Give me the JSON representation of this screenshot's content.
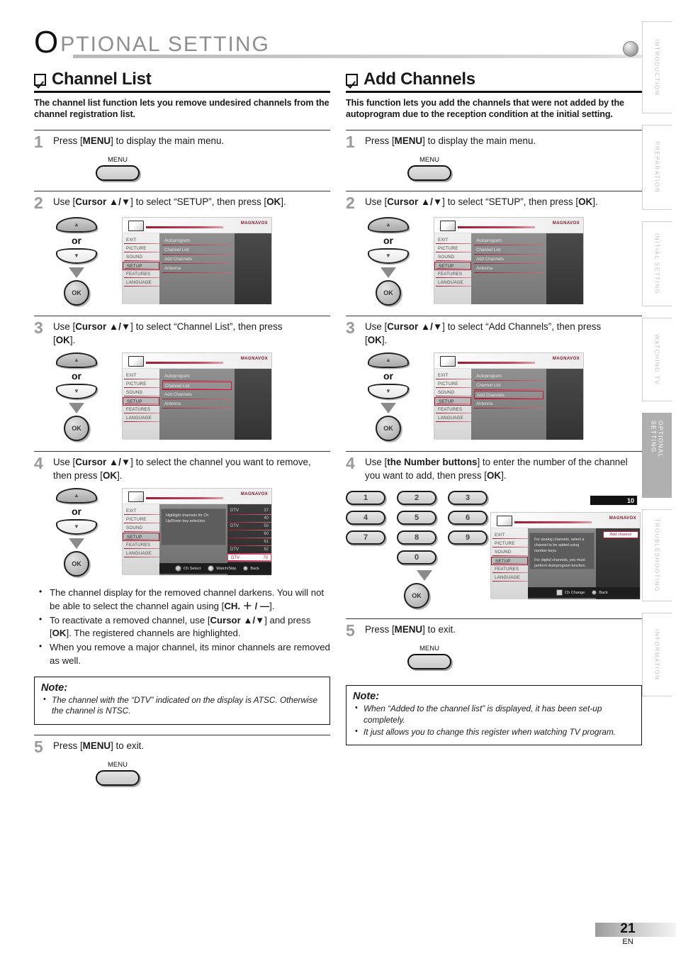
{
  "header": {
    "initial": "O",
    "rest": "PTIONAL  SETTING"
  },
  "sidebar": {
    "tabs": [
      {
        "label": "INTRODUCTION",
        "active": false
      },
      {
        "label": "PREPARATION",
        "active": false
      },
      {
        "label": "INITIAL  SETTING",
        "active": false
      },
      {
        "label": "WATCHING  TV",
        "active": false
      },
      {
        "label": "OPTIONAL  SETTING",
        "active": true
      },
      {
        "label": "TROUBLESHOOTING",
        "active": false
      },
      {
        "label": "INFORMATION",
        "active": false
      }
    ]
  },
  "footer": {
    "page_number": "21",
    "language": "EN"
  },
  "left": {
    "title": "Channel List",
    "description": "The channel list function lets you remove undesired channels from the channel registration list.",
    "steps": [
      {
        "num": "1",
        "text": "Press [MENU] to display the main menu.",
        "menu_label": "MENU"
      },
      {
        "num": "2",
        "text": "Use [Cursor ▲/▼] to select “SETUP”, then press [OK].",
        "or": "or",
        "ok": "OK"
      },
      {
        "num": "3",
        "text": "Use [Cursor ▲/▼] to select “Channel List”, then press [OK].",
        "or": "or",
        "ok": "OK"
      },
      {
        "num": "4",
        "text": "Use [Cursor ▲/▼] to select the channel you want to remove, then press [OK].",
        "or": "or",
        "ok": "OK"
      },
      {
        "num": "5",
        "text": "Press [MENU] to exit.",
        "menu_label": "MENU"
      }
    ],
    "bullets": [
      "The channel display for the removed channel darkens. You will not be able to select the channel again using [CH. ＋ / —].",
      "To reactivate a removed channel, use [Cursor ▲/▼] and press [OK]. The registered channels are highlighted.",
      "When you remove a major channel, its minor channels are removed as well."
    ],
    "note": {
      "title": "Note:",
      "items": [
        "The channel with the “DTV” indicated on the display is ATSC. Otherwise the channel is NTSC."
      ]
    }
  },
  "right": {
    "title": "Add Channels",
    "description": "This function lets you add the channels that were not added by the autoprogram due to the reception condition at the initial setting.",
    "steps": [
      {
        "num": "1",
        "text": "Press [MENU] to display the main menu.",
        "menu_label": "MENU"
      },
      {
        "num": "2",
        "text": "Use [Cursor ▲/▼] to select “SETUP”, then press [OK].",
        "or": "or",
        "ok": "OK"
      },
      {
        "num": "3",
        "text": "Use [Cursor ▲/▼] to select “Add Channels”, then press [OK].",
        "or": "or",
        "ok": "OK"
      },
      {
        "num": "4",
        "text": "Use [the Number buttons] to enter the number of the channel you want to add, then press [OK].",
        "ok": "OK"
      },
      {
        "num": "5",
        "text": "Press [MENU] to exit.",
        "menu_label": "MENU"
      }
    ],
    "numpad": {
      "keys": [
        "1",
        "2",
        "3",
        "4",
        "5",
        "6",
        "7",
        "8",
        "9",
        "0"
      ],
      "ok": "OK"
    },
    "note": {
      "title": "Note:",
      "items": [
        "When “Added to the channel list” is displayed, it has been set-up completely.",
        "It just allows you to change this register when watching TV program."
      ]
    }
  },
  "osd": {
    "brand": "MAGNAVOX",
    "left_menu": [
      "EXIT",
      "PICTURE",
      "SOUND",
      "SETUP",
      "FEATURES",
      "LANGUAGE"
    ],
    "setup_items": [
      "Autoprogram",
      "Channel List",
      "Add Channels",
      "Antenna"
    ],
    "selected_left": "SETUP",
    "selected_step2": "",
    "selected_step3_left": "Channel List",
    "selected_step3_right": "Add Channels",
    "channel_list": {
      "hint": "Highlight channels for Ch Up/Down key selection.",
      "rows": [
        {
          "type": "DTV",
          "num": "37",
          "sel": false
        },
        {
          "type": "",
          "num": "40",
          "sel": false
        },
        {
          "type": "DTV",
          "num": "50",
          "sel": false
        },
        {
          "type": "",
          "num": "60",
          "sel": false
        },
        {
          "type": "",
          "num": "61",
          "sel": false
        },
        {
          "type": "DTV",
          "num": "62",
          "sel": false
        },
        {
          "type": "DTV",
          "num": "70",
          "sel": true
        }
      ],
      "footer": [
        "Ch Select",
        "Watch/Skip",
        "Back"
      ]
    },
    "add_channel": {
      "badge": "10",
      "tag": "Add channel",
      "message_1": "For analog channels, select a channel to be added using number keys.",
      "message_2": "For digital channels, you must perform Autoprogram function.",
      "footer": [
        "Ch Change",
        "Back"
      ]
    }
  }
}
